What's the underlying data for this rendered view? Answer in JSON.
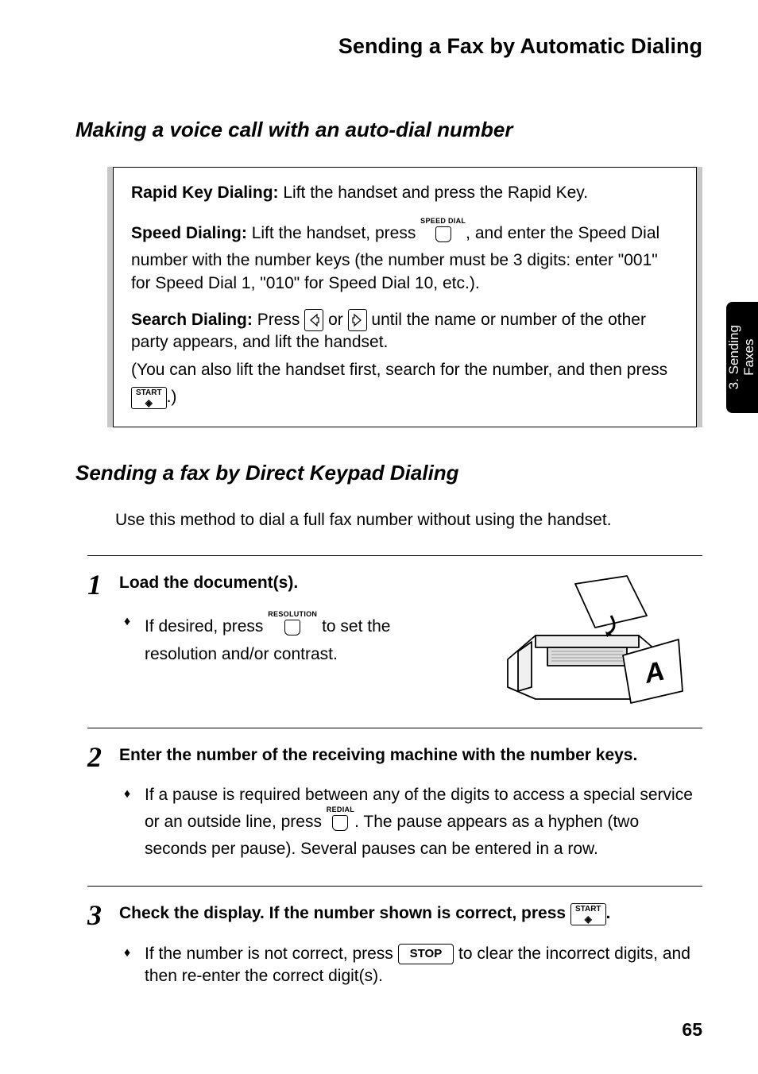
{
  "header": {
    "title": "Sending a Fax by Automatic Dialing"
  },
  "tab": {
    "line1": "3. Sending",
    "line2": "Faxes"
  },
  "page_number": "65",
  "section1": {
    "title": "Making a voice call with an auto-dial number",
    "rapid": {
      "label": "Rapid Key Dialing:",
      "text": " Lift the handset and press the Rapid Key."
    },
    "speed": {
      "label": "Speed Dialing:",
      "text_before": " Lift the handset, press ",
      "key_label": "SPEED DIAL",
      "text_after": ", and enter the Speed Dial number with the number keys (the number must be 3 digits: enter \"001\" for Speed Dial 1, \"010\" for Speed Dial 10, etc.)."
    },
    "search": {
      "label": "Search Dialing:",
      "text_before": " Press ",
      "or": " or ",
      "text_after": " until the name or number of the other party appears, and lift the handset.",
      "paren": "(You can also lift the handset first, search for the number, and then press ",
      "start_label": "START",
      "paren_end": ".)"
    }
  },
  "section2": {
    "title": "Sending a fax by Direct Keypad Dialing",
    "intro": "Use this method to dial a full fax number without using the handset.",
    "step1": {
      "num": "1",
      "head": "Load the document(s).",
      "bullet_before": "If desired, press ",
      "key_label": "RESOLUTION",
      "bullet_after": " to set the resolution and/or contrast."
    },
    "step2": {
      "num": "2",
      "head": "Enter the number of the receiving machine with the number keys.",
      "bullet_before": "If a pause is required between any of the digits to access a special service or an outside line, press ",
      "key_label": "REDIAL",
      "bullet_after": ". The pause appears as a hyphen (two seconds per pause). Several pauses can be entered in a row."
    },
    "step3": {
      "num": "3",
      "head_before": "Check the display. If the number shown is correct, press ",
      "start_label": "START",
      "head_after": ".",
      "bullet_before": "If the number is not correct, press ",
      "stop_label": "STOP",
      "bullet_after": " to clear the incorrect digits, and then re-enter the correct digit(s)."
    }
  }
}
